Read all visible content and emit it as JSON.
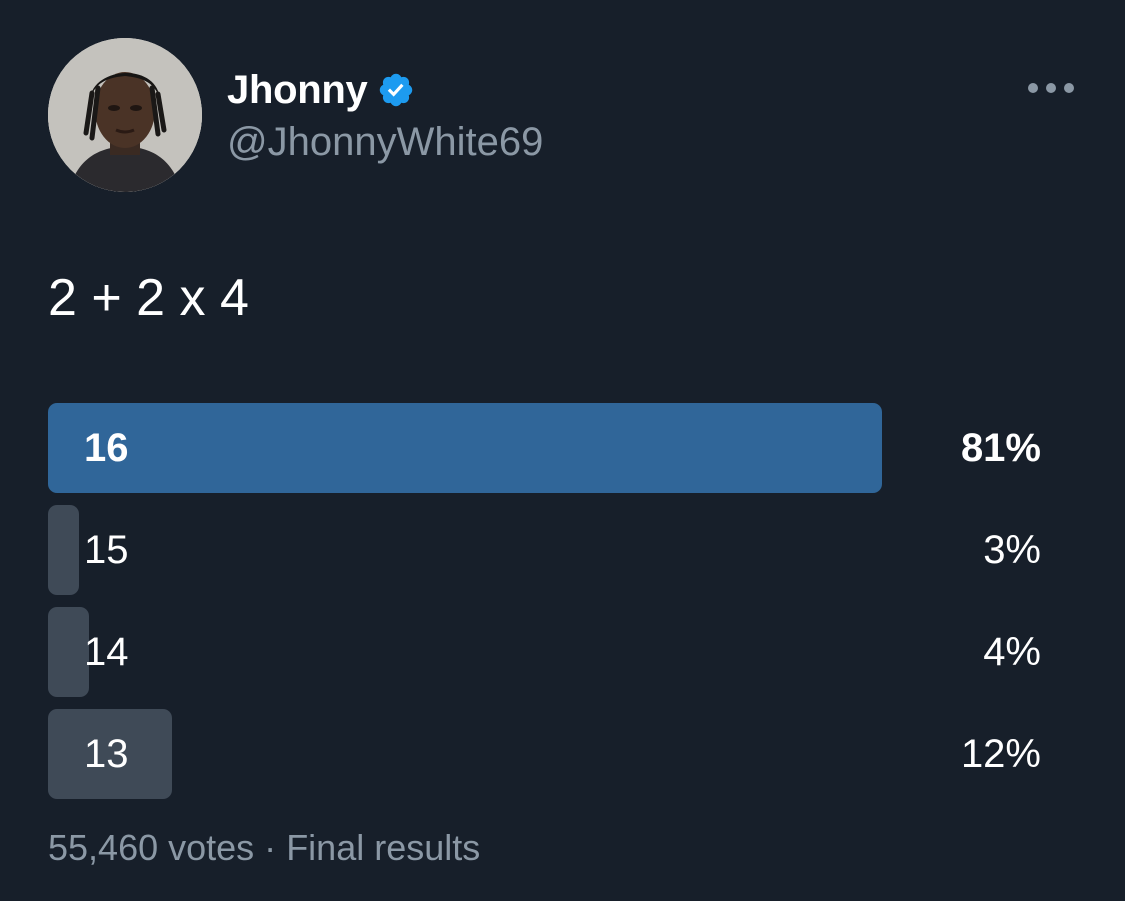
{
  "author": {
    "display_name": "Jhonny",
    "handle": "@JhonnyWhite69",
    "verified": true,
    "avatar_icon": "avatar-photo"
  },
  "tweet": {
    "text": "2 + 2 x 4"
  },
  "poll": {
    "options": [
      {
        "label": "16",
        "percent": 81,
        "percent_text": "81%",
        "winner": true
      },
      {
        "label": "15",
        "percent": 3,
        "percent_text": "3%",
        "winner": false
      },
      {
        "label": "14",
        "percent": 4,
        "percent_text": "4%",
        "winner": false
      },
      {
        "label": "13",
        "percent": 12,
        "percent_text": "12%",
        "winner": false
      }
    ],
    "votes_text": "55,460 votes",
    "separator": "·",
    "status_text": "Final results"
  },
  "icons": {
    "verified": "verified-badge-icon",
    "more": "more-options-icon"
  },
  "colors": {
    "background": "#171f2a",
    "winner_bar": "#306699",
    "other_bar": "#3f4a57",
    "verified_badge": "#1d9bf0",
    "secondary_text": "#8b98a5"
  }
}
